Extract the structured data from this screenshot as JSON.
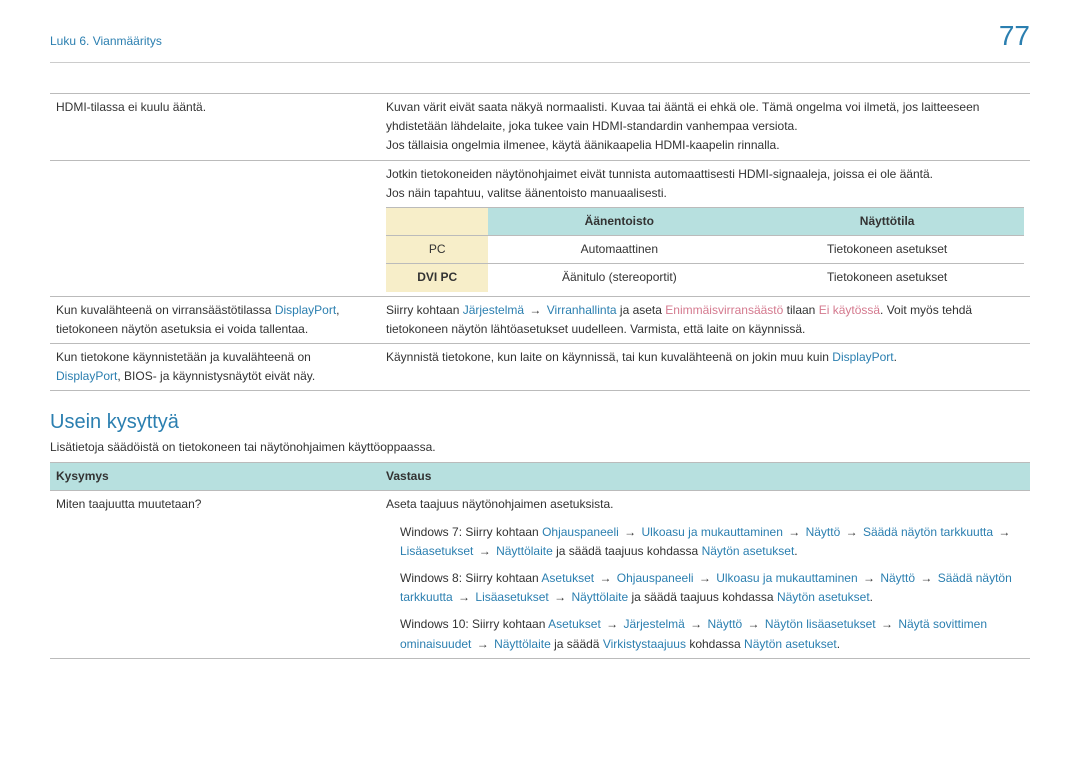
{
  "header": {
    "breadcrumb": "Luku 6. Vianmääritys",
    "pageNumber": "77"
  },
  "mainTable": {
    "row1": {
      "left": "HDMI-tilassa ei kuulu ääntä.",
      "p1": "Kuvan värit eivät saata näkyä normaalisti. Kuvaa tai ääntä ei ehkä ole. Tämä ongelma voi ilmetä, jos laitteeseen yhdistetään lähdelaite, joka tukee vain HDMI-standardin vanhempaa versiota.",
      "p2": "Jos tällaisia ongelmia ilmenee, käytä äänikaapelia HDMI-kaapelin rinnalla.",
      "p3": "Jotkin tietokoneiden näytönohjaimet eivät tunnista automaattisesti HDMI-signaaleja, joissa ei ole ääntä.",
      "p4": "Jos näin tapahtuu, valitse äänentoisto manuaalisesti.",
      "subHeaders": {
        "audio": "Äänentoisto",
        "display": "Näyttötila"
      },
      "subRows": [
        {
          "label": "PC",
          "audio": "Automaattinen",
          "display": "Tietokoneen asetukset"
        },
        {
          "label": "DVI PC",
          "audio": "Äänitulo (stereoportit)",
          "display": "Tietokoneen asetukset"
        }
      ]
    },
    "row2": {
      "left_pre": "Kun kuvalähteenä on virransäästötilassa ",
      "left_link": "DisplayPort",
      "left_post": ", tietokoneen näytön asetuksia ei voida tallentaa.",
      "right_pre": "Siirry kohtaan ",
      "right_j": "Järjestelmä",
      "right_v": "Virranhallinta",
      "right_mid": " ja aseta ",
      "right_e": "Enimmäisvirransäästö",
      "right_t": " tilaan ",
      "right_ek": "Ei käytössä",
      "right_post": ". Voit myös tehdä tietokoneen näytön lähtöasetukset uudelleen. Varmista, että laite on käynnissä."
    },
    "row3": {
      "left_pre": "Kun tietokone käynnistetään ja kuvalähteenä on ",
      "left_link": "DisplayPort",
      "left_post": ", BIOS- ja käynnistysnäytöt eivät näy.",
      "right_pre": "Käynnistä tietokone, kun laite on käynnissä, tai kun kuvalähteenä on jokin muu kuin ",
      "right_link": "DisplayPort",
      "right_post": "."
    }
  },
  "faq": {
    "title": "Usein kysyttyä",
    "desc": "Lisätietoja säädöistä on tietokoneen tai näytönohjaimen käyttöoppaassa.",
    "headers": {
      "q": "Kysymys",
      "a": "Vastaus"
    },
    "row": {
      "q": "Miten taajuutta muutetaan?",
      "a_intro": "Aseta taajuus näytönohjaimen asetuksista.",
      "w7": {
        "prefix": "Windows 7: Siirry kohtaan ",
        "l1": "Ohjauspaneeli",
        "l2": "Ulkoasu ja mukauttaminen",
        "l3": "Näyttö",
        "l4": "Säädä näytön tarkkuutta",
        "l5": "Lisäasetukset",
        "l6": "Näyttölaite",
        "mid": " ja säädä taajuus kohdassa ",
        "l7": "Näytön asetukset"
      },
      "w8": {
        "prefix": "Windows 8: Siirry kohtaan ",
        "l1": "Asetukset",
        "l2": "Ohjauspaneeli",
        "l3": "Ulkoasu ja mukauttaminen",
        "l4": "Näyttö",
        "l5": "Säädä näytön tarkkuutta",
        "l6": "Lisäasetukset",
        "l7": "Näyttölaite",
        "mid": " ja säädä taajuus kohdassa ",
        "l8": "Näytön asetukset"
      },
      "w10": {
        "prefix": "Windows 10: Siirry kohtaan ",
        "l1": "Asetukset",
        "l2": "Järjestelmä",
        "l3": "Näyttö",
        "l4": "Näytön lisäasetukset",
        "l5": "Näytä sovittimen ominaisuudet",
        "l6": "Näyttölaite",
        "mid": " ja säädä ",
        "l7": "Virkistystaajuus",
        "mid2": " kohdassa ",
        "l8": "Näytön asetukset"
      }
    }
  }
}
